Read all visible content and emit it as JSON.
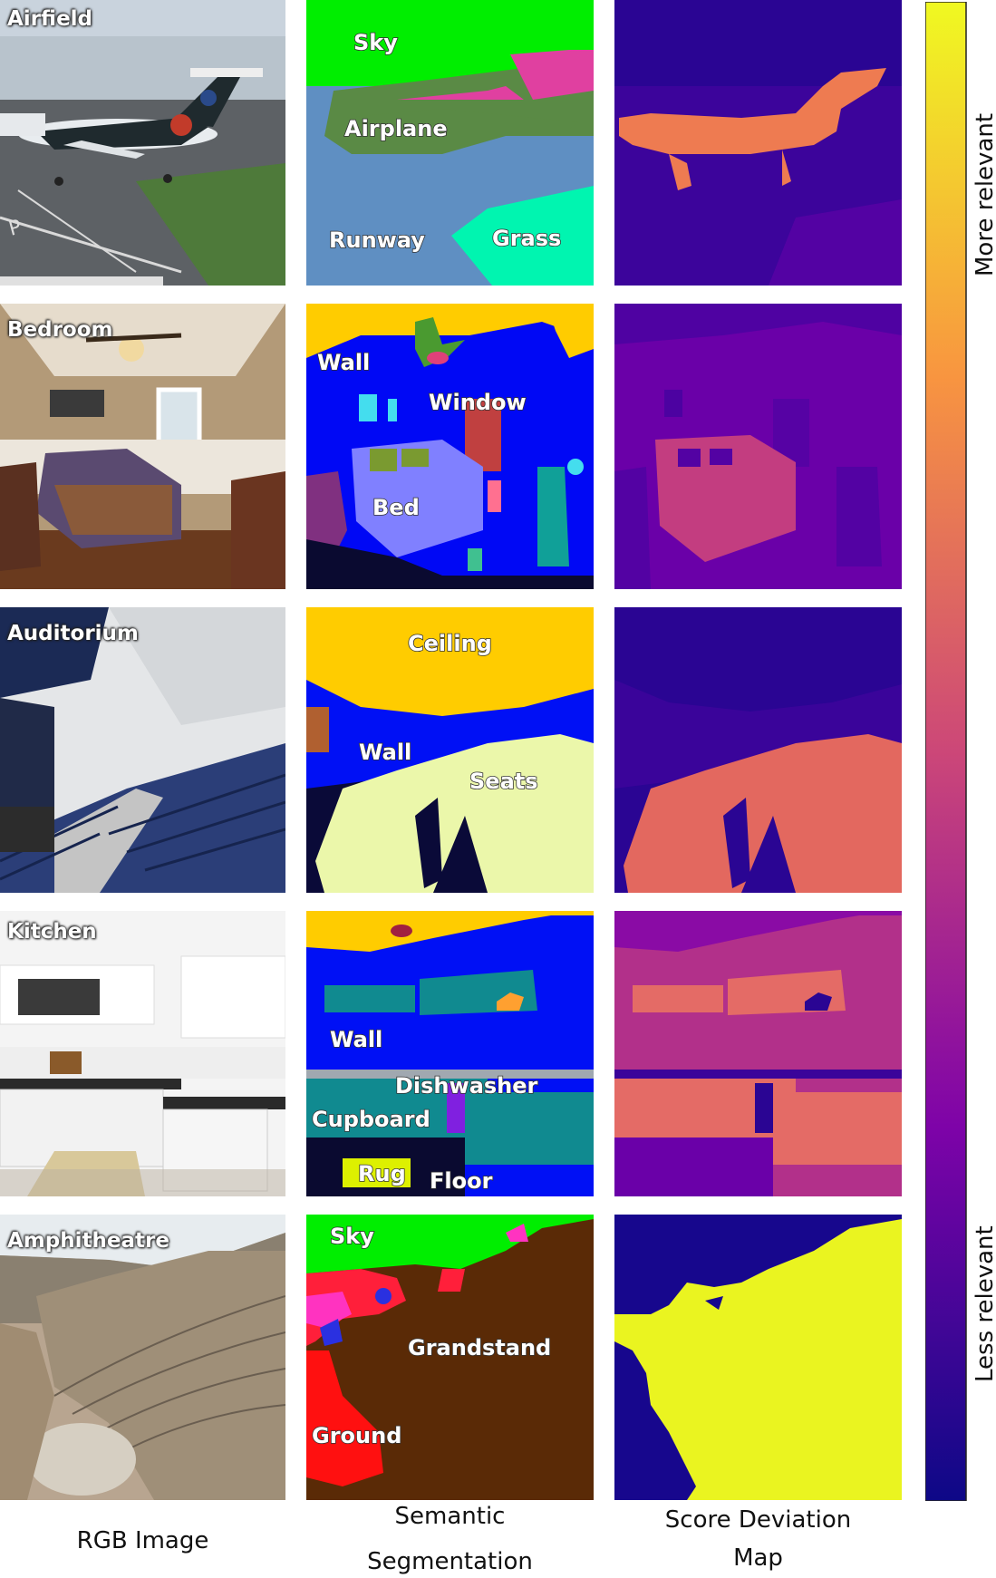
{
  "rows": [
    {
      "scene": "Airfield",
      "labels": [
        "Sky",
        "Airplane",
        "Runway",
        "Grass"
      ]
    },
    {
      "scene": "Bedroom",
      "labels": [
        "Wall",
        "Window",
        "Bed"
      ]
    },
    {
      "scene": "Auditorium",
      "labels": [
        "Ceiling",
        "Wall",
        "Seats"
      ]
    },
    {
      "scene": "Kitchen",
      "labels": [
        "Wall",
        "Dishwasher",
        "Cupboard",
        "Rug",
        "Floor"
      ]
    },
    {
      "scene": "Amphitheatre",
      "labels": [
        "Sky",
        "Grandstand",
        "Ground"
      ]
    }
  ],
  "columns": {
    "rgb": "RGB Image",
    "seg_line1": "Semantic",
    "seg_line2": "Segmentation",
    "score_line1": "Score Deviation",
    "score_line2": "Map"
  },
  "colorbar": {
    "top_label": "More relevant",
    "bottom_label": "Less relevant",
    "colors": [
      "#f0f921",
      "#f89540",
      "#cc4778",
      "#7e03a8",
      "#0d0887"
    ]
  }
}
